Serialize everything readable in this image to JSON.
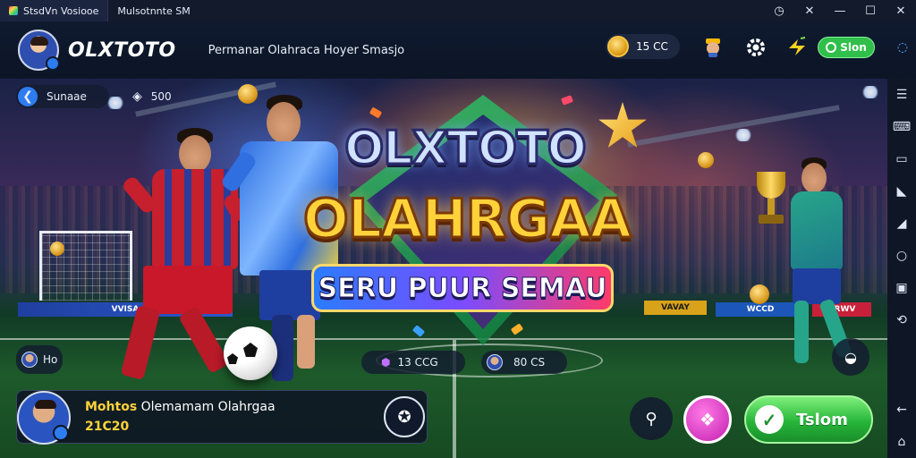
{
  "window": {
    "tabs": [
      {
        "label": "StsdVn Vosiooe",
        "active": true
      },
      {
        "label": "Mulsotnnte SM",
        "active": false
      }
    ],
    "controls": {
      "clock": "◷",
      "pin": "✕",
      "minimize": "—",
      "maximize": "☐",
      "close": "✕"
    }
  },
  "header": {
    "brand": "OLXTOTO",
    "subtitle": "Permanar Olahraca Hoyer Smasjo",
    "coins": "15 CC",
    "online_label": "Slon"
  },
  "stage": {
    "left_chip_label": "Sunaae",
    "left_chip_count": "500",
    "logo_line1": "OLXTOTO",
    "logo_line2": "OLAHRGAA",
    "ribbon": "SERU PUUR SEMAU",
    "adboards": [
      "VVISA",
      "VAVAY",
      "WCCD",
      "VRWV"
    ],
    "mini_left_label": "Ho",
    "center_chip_1": "13 CCG",
    "center_chip_2": "80 CS"
  },
  "bottom": {
    "title_highlight": "Mohtos",
    "title_rest": "Olemamam Olahrgaa",
    "subtitle": "21C20",
    "play_label": "Tslom"
  },
  "colors": {
    "accent_green": "#2fbf4a",
    "logo_gold": "#ffd23a",
    "ribbon_pink": "#ff3a6a",
    "ribbon_blue": "#2a7cff"
  },
  "icons": [
    "clock-icon",
    "pin-icon",
    "minimize-icon",
    "maximize-icon",
    "close-icon",
    "coin-icon",
    "gift-icon",
    "settings-icon",
    "bolt-icon",
    "online-icon",
    "share-icon",
    "back-arrow-icon",
    "shield-icon",
    "controller-icon",
    "location-icon",
    "diamond-icon",
    "check-icon"
  ]
}
